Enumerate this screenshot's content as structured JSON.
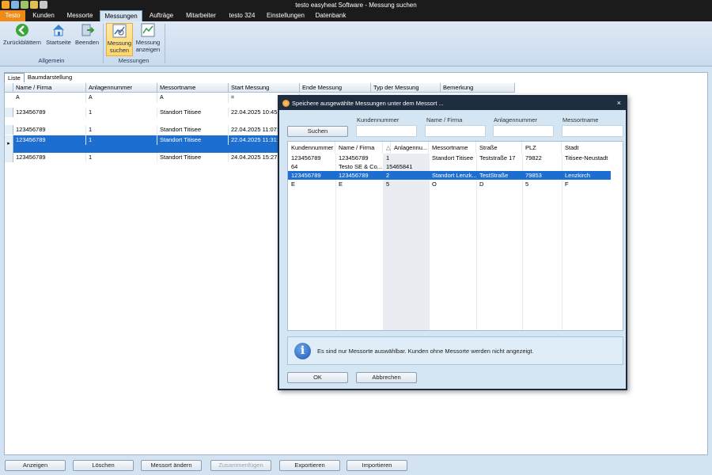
{
  "window": {
    "title": "testo easyheat Software - Messung suchen"
  },
  "tabs": [
    {
      "label": "Testo"
    },
    {
      "label": "Kunden"
    },
    {
      "label": "Messorte"
    },
    {
      "label": "Messungen"
    },
    {
      "label": "Aufträge"
    },
    {
      "label": "Mitarbeiter"
    },
    {
      "label": "testo 324"
    },
    {
      "label": "Einstellungen"
    },
    {
      "label": "Datenbank"
    }
  ],
  "ribbon": {
    "back": "Zurückblättern",
    "home": "Startseite",
    "exit": "Beenden",
    "search_l1": "Messung",
    "search_l2": "suchen",
    "show_l1": "Messung",
    "show_l2": "anzeigen",
    "group_general": "Allgemein",
    "group_measurements": "Messungen"
  },
  "viewtabs": [
    "Liste",
    "Baumdarstellung"
  ],
  "grid": {
    "headers": [
      "Name / Firma",
      "Anlagennummer",
      "Messortname",
      "Start Messung",
      "Ende Messung",
      "Typ der Messung",
      "Bemerkung"
    ],
    "filter_glyph": "A",
    "filter_eq": "=",
    "rows": [
      [
        "123456789",
        "1",
        "Standort Titisee",
        "22.04.2025 10:45:0"
      ],
      [
        "123456789",
        "1",
        "Standort Titisee",
        "22.04.2025 11:07:5"
      ],
      [
        "123456789",
        "1",
        "Standort Titisee",
        "22.04.2025 11:31:2"
      ],
      [
        "123456789",
        "1",
        "Standort Titisee",
        "24.04.2025 15:27:5"
      ]
    ]
  },
  "bottom_buttons": [
    "Anzeigen",
    "Löschen",
    "Messort ändern",
    "Zusammenfügen",
    "Exportieren",
    "Importieren"
  ],
  "dialog": {
    "title": "Speichere ausgewählte Messungen unter dem Messort ...",
    "close": "×",
    "search_labels": [
      "Kundennummer",
      "Name / Firma",
      "Anlagennummer",
      "Messortname"
    ],
    "search_button": "Suchen",
    "headers": [
      "Kundennummer",
      "Name / Firma",
      "Anlagennu...",
      "Messortname",
      "Straße",
      "PLZ",
      "Stadt"
    ],
    "sort_glyph": "△",
    "rows": [
      [
        "123456789",
        "123456789",
        "1",
        "Standort Titisee",
        "Teststraße 17",
        "79822",
        "Titisee-Neustadt"
      ],
      [
        "64",
        "Testo SE & Co...",
        "15465841",
        "",
        "",
        "",
        ""
      ],
      [
        "123456789",
        "123456789",
        "2",
        "Standort Lenzk...",
        "TestStraße",
        "79853",
        "Lenzkirch"
      ],
      [
        "E",
        "E",
        "5",
        "O",
        "D",
        "5",
        "F"
      ]
    ],
    "info_glyph": "i",
    "info": "Es sind nur Messorte auswählbar. Kunden ohne Messorte werden nicht angezeigt.",
    "ok": "OK",
    "cancel": "Abbrechen"
  },
  "colors": {
    "accent": "#f08a14",
    "selection": "#1c6fd1",
    "titlebar": "#1b1b1b"
  }
}
